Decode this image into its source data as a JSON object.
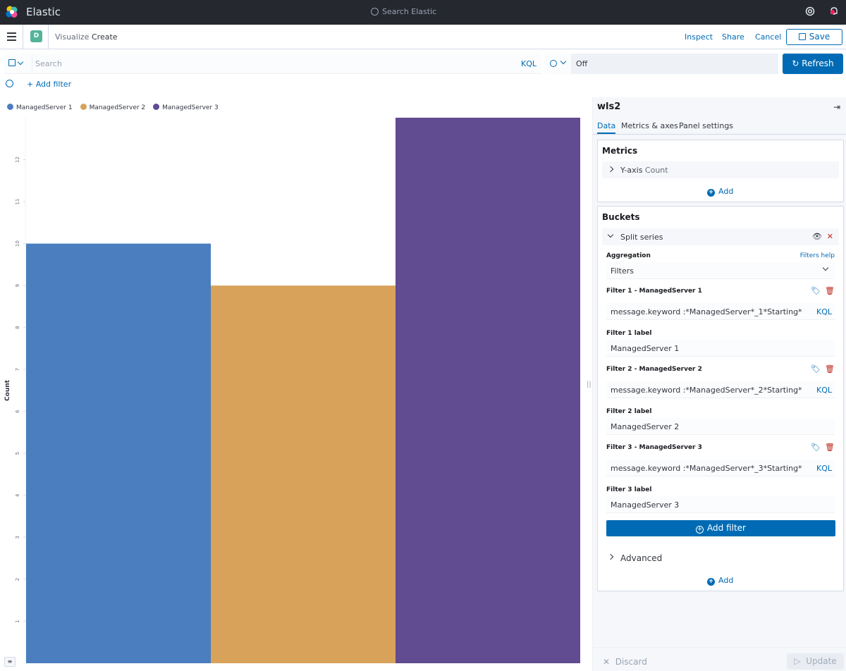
{
  "header": {
    "brand": "Elastic",
    "search_placeholder": "Search Elastic"
  },
  "subheader": {
    "space_letter": "D",
    "breadcrumbs": [
      "Visualize",
      "/",
      "Create"
    ],
    "inspect": "Inspect",
    "share": "Share",
    "cancel": "Cancel",
    "save": "Save"
  },
  "query": {
    "placeholder": "Search",
    "language": "KQL",
    "refresh_interval": "Off",
    "refresh_label": "Refresh",
    "add_filter": "+ Add filter"
  },
  "chart_data": {
    "type": "bar",
    "categories": [
      "ManagedServer 1",
      "ManagedServer 2",
      "ManagedServer 3"
    ],
    "values": [
      10,
      9,
      13
    ],
    "colors": [
      "#4a7ebf",
      "#d9a25b",
      "#614b91"
    ],
    "ylabel": "Count",
    "ylim": [
      0,
      13
    ],
    "yticks": [
      "1",
      "2",
      "3",
      "4",
      "5",
      "6",
      "7",
      "8",
      "9",
      "10",
      "11",
      "12"
    ],
    "legend": "top-left"
  },
  "sidebar": {
    "title": "wls2",
    "tabs": [
      "Data",
      "Metrics & axes",
      "Panel settings"
    ],
    "metrics": {
      "heading": "Metrics",
      "yaxis_label": "Y-axis",
      "yaxis_sub": "Count",
      "add": "Add"
    },
    "buckets": {
      "heading": "Buckets",
      "split_series": "Split series",
      "aggregation_label": "Aggregation",
      "filters_help": "Filters help",
      "aggregation_value": "Filters",
      "filters": [
        {
          "title": "Filter 1 - ManagedServer 1",
          "query": "message.keyword :*ManagedServer*_1*Starting*",
          "label_title": "Filter 1 label",
          "label": "ManagedServer 1"
        },
        {
          "title": "Filter 2 - ManagedServer 2",
          "query": "message.keyword :*ManagedServer*_2*Starting*",
          "label_title": "Filter 2 label",
          "label": "ManagedServer 2"
        },
        {
          "title": "Filter 3 - ManagedServer 3",
          "query": "message.keyword :*ManagedServer*_3*Starting*",
          "label_title": "Filter 3 label",
          "label": "ManagedServer 3"
        }
      ],
      "query_lang": "KQL",
      "add_filter": "Add filter",
      "advanced": "Advanced",
      "add": "Add"
    },
    "footer": {
      "discard": "Discard",
      "update": "Update"
    }
  }
}
